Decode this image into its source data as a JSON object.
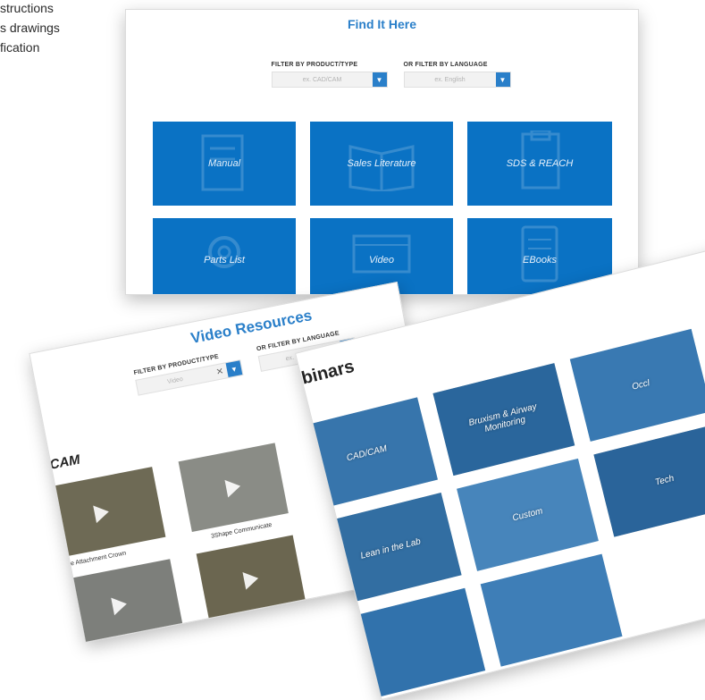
{
  "side_text": [
    "structions",
    "s drawings",
    "fication"
  ],
  "find_panel": {
    "title": "Find It Here",
    "filter_product_label": "FILTER BY PRODUCT/TYPE",
    "filter_product_value": "ex. CAD/CAM",
    "filter_language_label": "OR FILTER BY LANGUAGE",
    "filter_language_value": "ex. English",
    "tiles": [
      "Manual",
      "Sales Literature",
      "SDS & REACH",
      "Parts List",
      "Video",
      "EBooks"
    ],
    "tile_icons": [
      "manual-icon",
      "sales-literature-icon",
      "sds-reach-icon",
      "parts-list-icon",
      "video-icon",
      "ebooks-icon"
    ]
  },
  "video_panel": {
    "title": "Video Resources",
    "filter_product_label": "FILTER BY PRODUCT/TYPE",
    "filter_product_value": "Video",
    "filter_language_label": "OR FILTER BY LANGUAGE",
    "filter_language_value": "ex. English",
    "section_heading": "/CAM",
    "videos": [
      {
        "caption": "e Attachment Crown"
      },
      {
        "caption": "3Shape Communicate"
      },
      {
        "caption": ""
      },
      {
        "caption": ""
      }
    ]
  },
  "webinar_panel": {
    "title": "Webinars",
    "tiles": [
      "CAD/CAM",
      "Bruxism & Airway Monitoring",
      "Occl",
      "Lean in the Lab",
      "Custom",
      "Tech",
      "",
      ""
    ]
  },
  "colors": {
    "accent": "#2a7fc9",
    "tile_blue": "#0a72c4",
    "webinar_blue": "#2f7dbd"
  }
}
